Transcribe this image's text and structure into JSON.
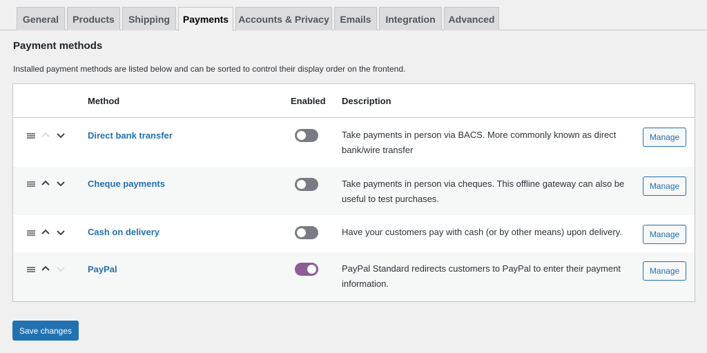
{
  "tabs": [
    {
      "label": "General"
    },
    {
      "label": "Products"
    },
    {
      "label": "Shipping"
    },
    {
      "label": "Payments",
      "active": true
    },
    {
      "label": "Accounts & Privacy"
    },
    {
      "label": "Emails"
    },
    {
      "label": "Integration"
    },
    {
      "label": "Advanced"
    }
  ],
  "section": {
    "title": "Payment methods",
    "description": "Installed payment methods are listed below and can be sorted to control their display order on the frontend."
  },
  "table": {
    "headers": {
      "method": "Method",
      "enabled": "Enabled",
      "description": "Description"
    },
    "rows": [
      {
        "name": "Direct bank transfer",
        "enabled": false,
        "description": "Take payments in person via BACS. More commonly known as direct bank/wire transfer",
        "manage_label": "Manage",
        "up_disabled": true,
        "down_disabled": false
      },
      {
        "name": "Cheque payments",
        "enabled": false,
        "description": "Take payments in person via cheques. This offline gateway can also be useful to test purchases.",
        "manage_label": "Manage",
        "up_disabled": false,
        "down_disabled": false
      },
      {
        "name": "Cash on delivery",
        "enabled": false,
        "description": "Have your customers pay with cash (or by other means) upon delivery.",
        "manage_label": "Manage",
        "up_disabled": false,
        "down_disabled": false
      },
      {
        "name": "PayPal",
        "enabled": true,
        "description": "PayPal Standard redirects customers to PayPal to enter their payment information.",
        "manage_label": "Manage",
        "up_disabled": false,
        "down_disabled": true
      }
    ]
  },
  "footer": {
    "save_label": "Save changes"
  },
  "colors": {
    "accent": "#2271b1",
    "toggle_on": "#8c5c97",
    "toggle_off": "#787c82"
  }
}
